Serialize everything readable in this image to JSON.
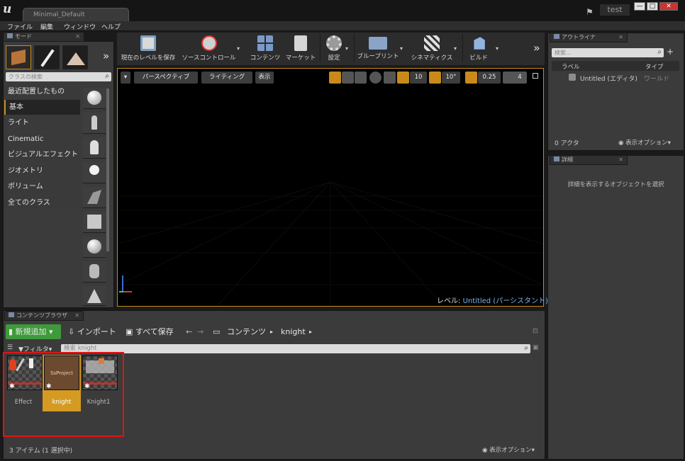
{
  "window": {
    "doc_tab": "Minimal_Default",
    "project": "test",
    "min": "—",
    "max": "□",
    "close": "✕"
  },
  "menu": [
    "ファイル",
    "編集",
    "ウィンドウ",
    "ヘルプ"
  ],
  "modes": {
    "tab": "モード",
    "search_placeholder": "クラスの検索",
    "categories": [
      "最近配置したもの",
      "基本",
      "ライト",
      "Cinematic",
      "ビジュアルエフェクト",
      "ジオメトリ",
      "ボリューム",
      "全てのクラス"
    ],
    "selected": "基本"
  },
  "toolbar": {
    "items": [
      "現在のレベルを保存",
      "ソースコントロール",
      "コンテンツ",
      "マーケット",
      "設定",
      "ブループリント",
      "シネマティクス",
      "ビルド"
    ],
    "more": "»"
  },
  "viewport": {
    "perspective": "パースペクティブ",
    "lighting": "ライティング",
    "show": "表示",
    "grid": "10",
    "rot": "10°",
    "scale": "0.25",
    "speed": "4",
    "level_label": "レベル:",
    "level_name": "Untitled (パーシスタント)"
  },
  "outliner": {
    "tab": "アウトライナ",
    "search_placeholder": "検索...",
    "col_label": "ラベル",
    "col_type": "タイプ",
    "row_name": "Untitled (エディタ)",
    "row_type": "ワールド",
    "count": "0 アクタ",
    "view_options": "表示オプション"
  },
  "details": {
    "tab": "詳細",
    "hint": "詳細を表示するオブジェクトを選択"
  },
  "content": {
    "tab": "コンテンツブラウザ",
    "add_new": "新規追加",
    "import": "インポート",
    "save_all": "すべて保存",
    "path_root": "コンテンツ",
    "path_folder": "knight",
    "filter": "フィルタ",
    "search_placeholder": "検索 knight",
    "assets": [
      {
        "name": "Effect",
        "label": ""
      },
      {
        "name": "knight",
        "label": "SsProject"
      },
      {
        "name": "Knight1",
        "label": ""
      }
    ],
    "status": "3 アイテム (1 選択中)",
    "view_options": "表示オプション"
  },
  "colors": {
    "accent": "#c98a1b",
    "selection_box": "#e01414",
    "add_button": "#3e9a3a"
  }
}
